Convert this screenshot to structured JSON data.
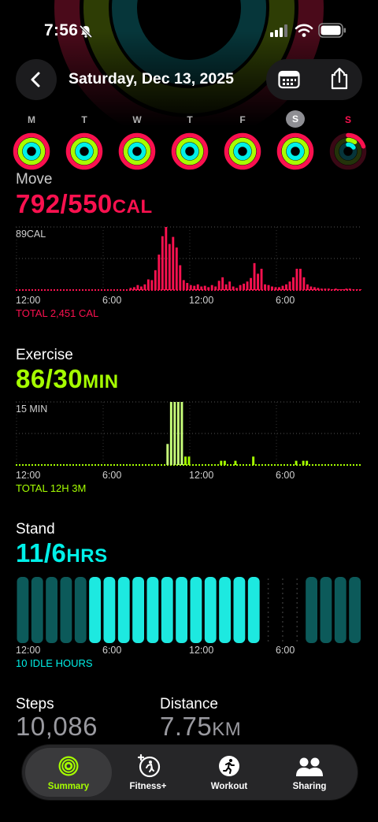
{
  "status_bar": {
    "time": "7:56"
  },
  "header": {
    "title": "Saturday, Dec 13, 2025"
  },
  "week": {
    "days": [
      {
        "label": "M",
        "move": 1.0,
        "exercise": 1.0,
        "stand": 1.0
      },
      {
        "label": "T",
        "move": 1.0,
        "exercise": 1.0,
        "stand": 1.0
      },
      {
        "label": "W",
        "move": 1.0,
        "exercise": 1.0,
        "stand": 1.0
      },
      {
        "label": "T",
        "move": 1.0,
        "exercise": 1.0,
        "stand": 1.0
      },
      {
        "label": "F",
        "move": 1.0,
        "exercise": 1.0,
        "stand": 1.0
      },
      {
        "label": "S",
        "move": 1.0,
        "exercise": 1.0,
        "stand": 1.0,
        "selected": true
      },
      {
        "label": "S",
        "move": 0.2,
        "exercise": 0.1,
        "stand": 0.15,
        "today": true
      }
    ]
  },
  "move": {
    "title": "Move",
    "value": "792/550",
    "unit": "CAL",
    "max_label": "89CAL",
    "total": "TOTAL 2,451 CAL",
    "color": "#fa114f"
  },
  "exercise": {
    "title": "Exercise",
    "value": "86/30",
    "unit": "MIN",
    "max_label": "15 MIN",
    "total": "TOTAL 12H 3M",
    "color": "#a6ff00"
  },
  "stand": {
    "title": "Stand",
    "value": "11/6",
    "unit": "HRS",
    "total": "10 IDLE HOURS",
    "color": "#00f0e8"
  },
  "axis_ticks": [
    "12:00",
    "6:00",
    "12:00",
    "6:00"
  ],
  "steps": {
    "label": "Steps",
    "value": "10,086"
  },
  "distance": {
    "label": "Distance",
    "value": "7.75",
    "unit": "KM"
  },
  "tabs": [
    {
      "label": "Summary",
      "icon": "summary-rings-icon",
      "selected": true
    },
    {
      "label": "Fitness+",
      "icon": "fitness-plus-icon"
    },
    {
      "label": "Workout",
      "icon": "workout-runner-icon"
    },
    {
      "label": "Sharing",
      "icon": "sharing-people-icon"
    }
  ],
  "chart_data": [
    {
      "type": "bar",
      "title": "Move",
      "ylabel": "89CAL",
      "x_ticks": [
        "12:00",
        "6:00",
        "12:00",
        "6:00"
      ],
      "ylim": [
        0,
        89
      ],
      "series": [
        {
          "values": [
            0,
            0,
            0,
            0,
            0,
            0,
            0,
            0,
            0,
            0,
            0,
            0,
            0,
            0,
            0,
            0,
            0,
            0,
            0,
            0,
            0,
            0,
            0,
            0,
            0,
            0,
            0,
            0,
            0,
            0,
            0,
            0,
            3,
            4,
            7,
            5,
            8,
            15,
            14,
            28,
            50,
            76,
            89,
            65,
            75,
            60,
            35,
            14,
            10,
            7,
            6,
            8,
            5,
            6,
            4,
            7,
            5,
            13,
            18,
            8,
            12,
            5,
            3,
            7,
            9,
            12,
            17,
            38,
            23,
            30,
            8,
            7,
            5,
            4,
            4,
            6,
            8,
            12,
            18,
            30,
            30,
            18,
            8,
            5,
            4,
            3,
            2,
            2,
            2,
            1,
            2,
            1,
            1,
            2,
            2,
            1,
            1,
            1
          ]
        }
      ]
    },
    {
      "type": "bar",
      "title": "Exercise",
      "ylabel": "15 MIN",
      "x_ticks": [
        "12:00",
        "6:00",
        "12:00",
        "6:00"
      ],
      "ylim": [
        0,
        15
      ],
      "series": [
        {
          "values": [
            0,
            0,
            0,
            0,
            0,
            0,
            0,
            0,
            0,
            0,
            0,
            0,
            0,
            0,
            0,
            0,
            0,
            0,
            0,
            0,
            0,
            0,
            0,
            0,
            0,
            0,
            0,
            0,
            0,
            0,
            0,
            0,
            0,
            0,
            0,
            0,
            0,
            0,
            0,
            0,
            0,
            0,
            5,
            15,
            15,
            15,
            15,
            2,
            2,
            0,
            0,
            0,
            0,
            0,
            0,
            0,
            0,
            1,
            1,
            0,
            0,
            1,
            0,
            0,
            0,
            0,
            2,
            0,
            0,
            0,
            0,
            0,
            0,
            0,
            0,
            0,
            0,
            0,
            1,
            0,
            1,
            1,
            0,
            0,
            0,
            0,
            0,
            0,
            0,
            0,
            0,
            0,
            0,
            0,
            0,
            0,
            0
          ]
        }
      ]
    },
    {
      "type": "bar",
      "title": "Stand",
      "x_ticks": [
        "12:00",
        "6:00",
        "12:00",
        "6:00"
      ],
      "ylim": [
        0,
        1
      ],
      "series": [
        {
          "values": [
            1,
            1,
            1,
            1,
            1,
            1,
            1,
            1,
            1,
            1,
            1,
            1,
            1,
            1,
            1,
            1,
            1,
            0,
            0,
            0,
            1,
            1,
            1,
            1
          ]
        }
      ]
    }
  ]
}
